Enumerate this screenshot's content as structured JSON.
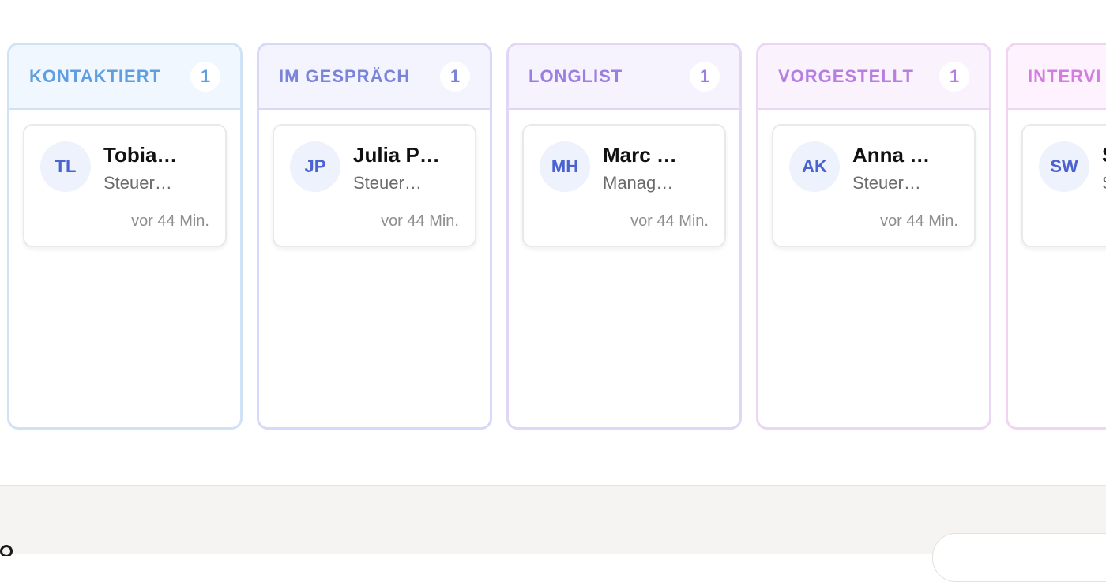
{
  "board": {
    "columns": [
      {
        "title": "KONTAKTIERT",
        "count": "1",
        "card": {
          "initials": "TL",
          "name": "Tobia…",
          "role": "Steuer…",
          "time": "vor 44 Min."
        }
      },
      {
        "title": "IM GESPRÄCH",
        "count": "1",
        "card": {
          "initials": "JP",
          "name": "Julia P…",
          "role": "Steuer…",
          "time": "vor 44 Min."
        }
      },
      {
        "title": "LONGLIST",
        "count": "1",
        "card": {
          "initials": "MH",
          "name": "Marc …",
          "role": "Manag…",
          "time": "vor 44 Min."
        }
      },
      {
        "title": "VORGESTELLT",
        "count": "1",
        "card": {
          "initials": "AK",
          "name": "Anna …",
          "role": "Steuer…",
          "time": "vor 44 Min."
        }
      },
      {
        "title": "INTERVI",
        "count": "",
        "card": {
          "initials": "SW",
          "name": "S",
          "role": "S",
          "time": ""
        }
      }
    ]
  },
  "colors": {
    "kontaktiert": "#5f9fe0",
    "im_gespraech": "#7a84d8",
    "longlist": "#9a7fe0",
    "vorgestellt": "#b67ee0",
    "interview": "#d27ee0",
    "avatar_text": "#4a63d1",
    "avatar_bg": "#eef2fd"
  }
}
